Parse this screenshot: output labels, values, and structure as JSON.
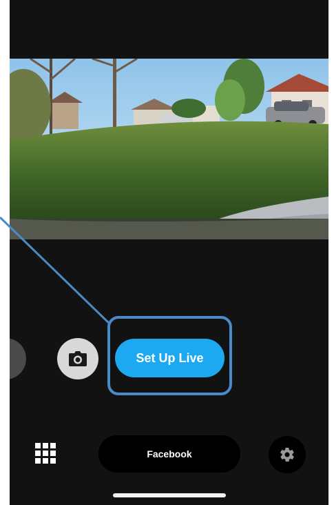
{
  "main": {
    "setup_live_label": "Set Up Live",
    "platform_label": "Facebook"
  },
  "icons": {
    "mode_prev": "mode-carousel-icon",
    "camera": "camera-icon",
    "grid": "grid-icon",
    "settings": "gear-icon"
  },
  "colors": {
    "accent": "#1da9f1",
    "callout": "#4b8ac9",
    "background": "#121212"
  }
}
